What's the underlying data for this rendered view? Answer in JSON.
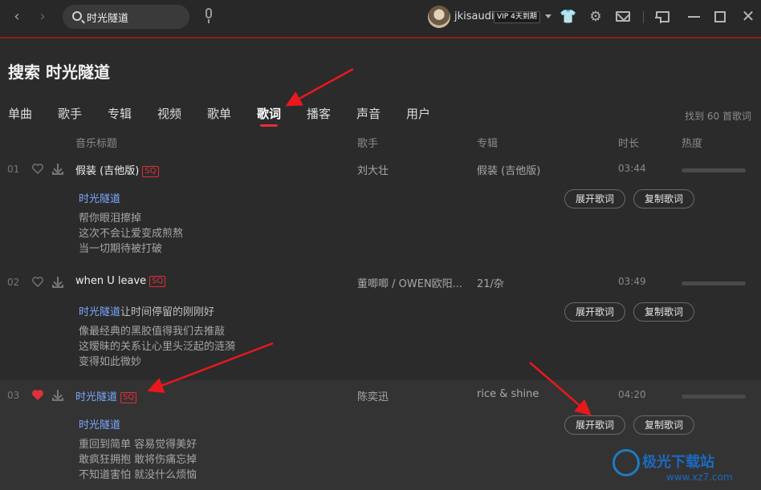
{
  "window": {
    "search_value": "时光隧道",
    "username": "jkisaudi",
    "vip_badge": "VIP 4天到期"
  },
  "header": {
    "title": "搜索 时光隧道",
    "tabs": [
      "单曲",
      "歌手",
      "专辑",
      "视频",
      "歌单",
      "歌词",
      "播客",
      "声音",
      "用户"
    ],
    "active_tab": "歌词",
    "result_count": "找到 60 首歌词"
  },
  "columns": {
    "title": "音乐标题",
    "artist": "歌手",
    "album": "专辑",
    "duration": "时长",
    "heat": "热度"
  },
  "songs": [
    {
      "index": "01",
      "title": "假装 (吉他版)",
      "quality": "SQ",
      "artist": "刘大壮",
      "album": "假装 (吉他版)",
      "duration": "03:44",
      "liked": false,
      "lyric_match": "时光隧道",
      "lyric_match_rest": "",
      "lyric_lines": [
        "帮你眼泪擦掉",
        "这次不会让爱变成煎熬",
        "当一切期待被打破"
      ]
    },
    {
      "index": "02",
      "title": "when U leave",
      "quality": "SQ",
      "artist": "董唧唧 / OWEN欧阳...",
      "album": "21/杂",
      "duration": "03:49",
      "liked": false,
      "lyric_match": "时光隧道",
      "lyric_match_rest": "让时间停留的刚刚好",
      "lyric_lines": [
        "像最经典的黑胶值得我们去推敲",
        "这暧昧的关系让心里头泛起的涟漪",
        "变得如此微妙"
      ]
    },
    {
      "index": "03",
      "title": "时光隧道",
      "quality": "SQ",
      "artist": "陈奕迅",
      "album": "rice & shine",
      "duration": "04:20",
      "liked": true,
      "lyric_match": "时光隧道",
      "lyric_match_rest": "",
      "lyric_lines": [
        "重回到简单 容易觉得美好",
        "敢疯狂拥抱 敢将伤痛忘掉",
        "不知道害怕 就没什么烦恼"
      ]
    }
  ],
  "buttons": {
    "expand": "展开歌词",
    "copy": "复制歌词"
  },
  "watermark": {
    "name": "极光下载站",
    "url": "www.xz7.com"
  },
  "colors": {
    "accent_red": "#e0303a",
    "lyric_blue": "#7aa8ff",
    "background": "#2b2b2b"
  }
}
